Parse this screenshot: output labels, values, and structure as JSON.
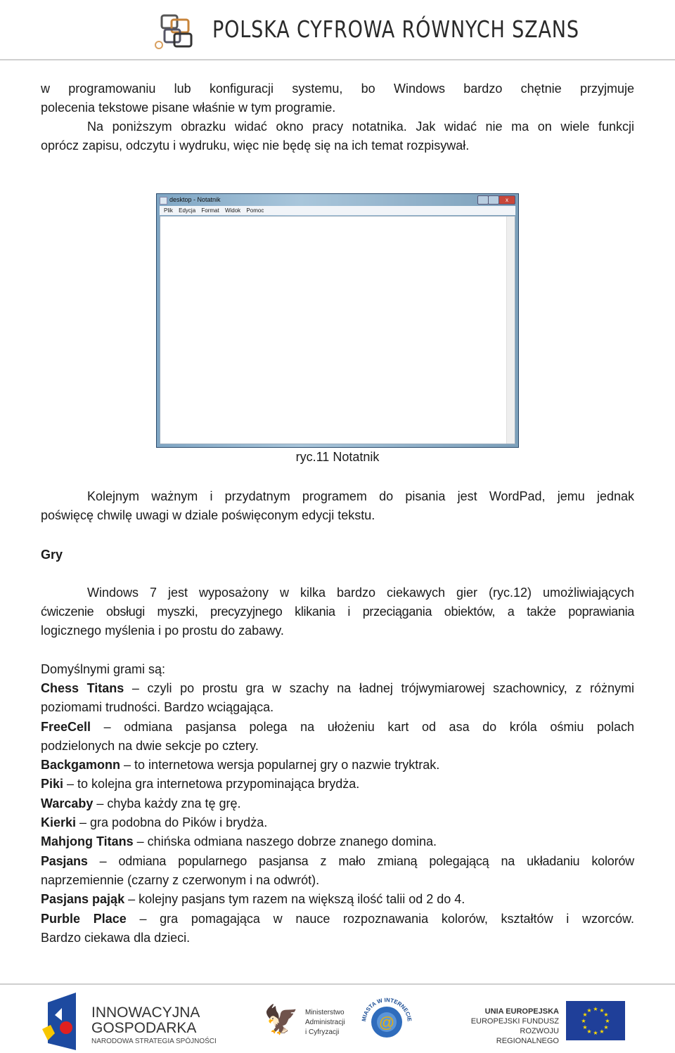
{
  "header": {
    "logo_text": "POLSKA CYFROWA RÓWNYCH SZANS"
  },
  "p1": [
    "w programowaniu lub konfiguracji systemu, bo Windows bardzo chętnie przyjmuje",
    "polecenia tekstowe pisane właśnie w tym programie.",
    "Na poniższym obrazku widać okno pracy notatnika. Jak widać nie ma on wiele funkcji",
    "oprócz zapisu, odczytu i wydruku, więc nie będę się na ich temat rozpisywał."
  ],
  "notepad": {
    "title": "desktop - Notatnik",
    "menu": [
      "Plik",
      "Edycja",
      "Format",
      "Widok",
      "Pomoc"
    ],
    "close": "x"
  },
  "caption": "ryc.11 Notatnik",
  "p2": [
    "Kolejnym ważnym i przydatnym programem do pisania jest WordPad, jemu jednak",
    "poświęcę chwilę uwagi w dziale poświęconym edycji tekstu."
  ],
  "heading": "Gry",
  "p3": [
    "Windows 7 jest wyposażony w kilka bardzo ciekawych gier (ryc.12) umożliwiających",
    "ćwiczenie obsługi myszki, precyzyjnego klikania i przeciągania obiektów, a także poprawiania",
    "logicznego myślenia i po prostu do zabawy."
  ],
  "list_intro": "Domyślnymi grami są:",
  "games": [
    {
      "term": "Chess Titans",
      "l1": " – czyli po prostu gra w szachy na ładnej trójwymiarowej szachownicy, z różnymi",
      "l2": "poziomami trudności. Bardzo wciągająca."
    },
    {
      "term": "FreeCell",
      "l1": " – odmiana pasjansa polega na ułożeniu kart od asa do króla ośmiu polach",
      "l2": "podzielonych na dwie sekcje po cztery."
    },
    {
      "term": "Backgamonn",
      "l1": " – to internetowa wersja popularnej gry o nazwie tryktrak."
    },
    {
      "term": "Piki",
      "l1": " – to kolejna gra internetowa przypominająca brydża."
    },
    {
      "term": "Warcaby",
      "l1": " – chyba każdy zna tę grę."
    },
    {
      "term": "Kierki",
      "l1": " – gra podobna do Pików i brydża."
    },
    {
      "term": "Mahjong Titans",
      "l1": " – chińska odmiana naszego dobrze znanego domina."
    },
    {
      "term": "Pasjans",
      "l1": " – odmiana popularnego pasjansa z mało zmianą polegającą na układaniu kolorów",
      "l2": "naprzemiennie (czarny z czerwonym i na odwrót)."
    },
    {
      "term": "Pasjans pająk",
      "l1": " – kolejny pasjans tym razem na większą ilość talii od 2 do 4."
    },
    {
      "term": "Purble Place",
      "l1": " – gra pomagająca w nauce rozpoznawania kolorów, kształtów i wzorców.",
      "l2": "Bardzo ciekawa dla dzieci."
    }
  ],
  "footer": {
    "ig1": "INNOWACYJNA",
    "ig2": "GOSPODARKA",
    "ig3": "NARODOWA STRATEGIA SPÓJNOŚCI",
    "mac1": "Ministerstwo",
    "mac2": "Administracji",
    "mac3": "i Cyfryzacji",
    "miw": "MIASTA W INTERNECIE",
    "ue1": "UNIA EUROPEJSKA",
    "ue2": "EUROPEJSKI FUNDUSZ",
    "ue3": "ROZWOJU REGIONALNEGO"
  },
  "colors": {
    "eu_blue": "#1f3f99",
    "eu_star": "#ffdd00"
  }
}
